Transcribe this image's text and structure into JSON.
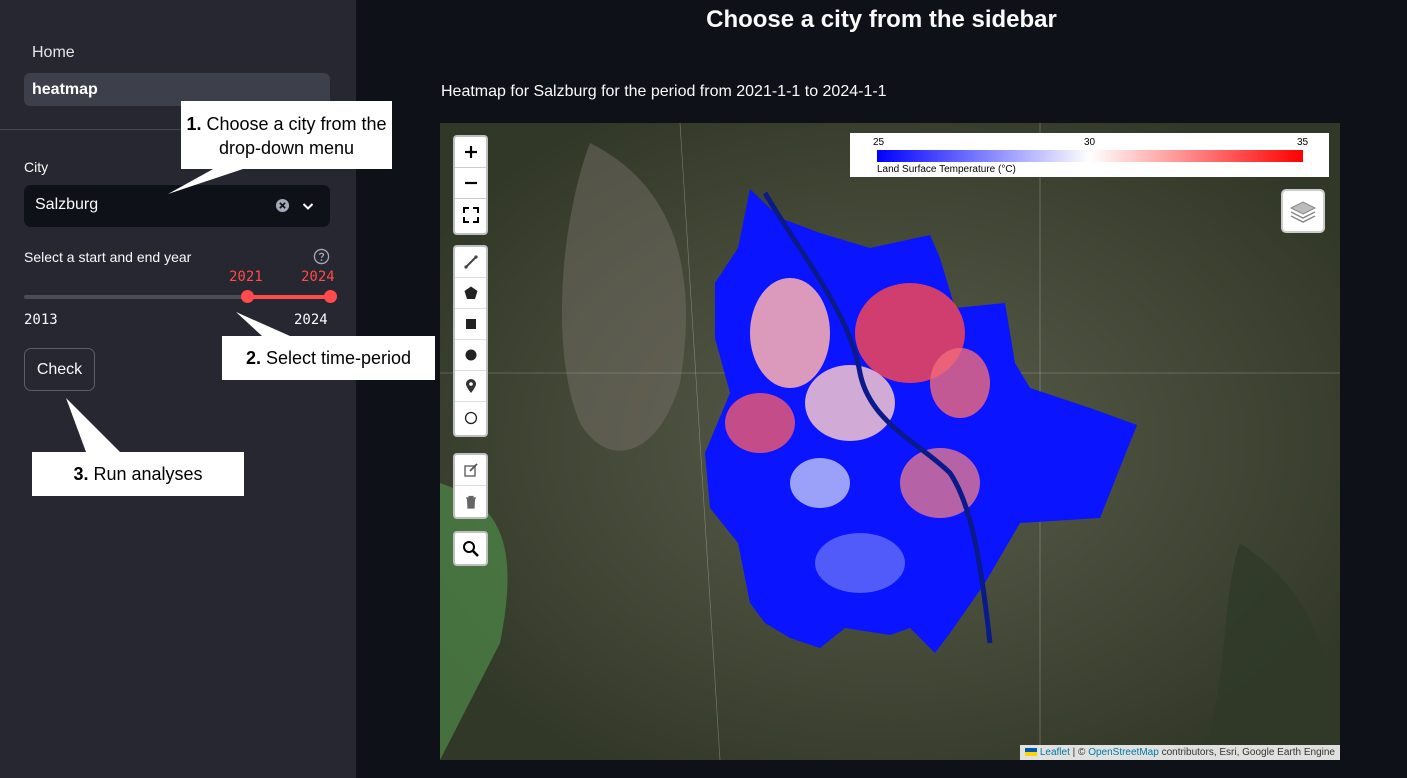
{
  "sidebar": {
    "nav": [
      {
        "label": "Home"
      },
      {
        "label": "heatmap"
      }
    ],
    "city": {
      "label": "City",
      "selected": "Salzburg"
    },
    "year_range": {
      "label": "Select a start and end year",
      "min": "2013",
      "max": "2024",
      "start": "2021",
      "end": "2024",
      "start_fraction": 0.727,
      "end_fraction": 1.0
    },
    "check_label": "Check"
  },
  "callouts": {
    "one": {
      "num": "1.",
      "text": "Choose a city from the drop-down menu"
    },
    "two": {
      "num": "2.",
      "text": "Select time-period"
    },
    "three": {
      "num": "3.",
      "text": "Run analyses"
    }
  },
  "main": {
    "title": "Choose a city from the sidebar",
    "subtitle": "Heatmap for Salzburg for the period from 2021-1-1 to 2024-1-1"
  },
  "map": {
    "legend": {
      "min": "25",
      "mid": "30",
      "max": "35",
      "caption": "Land Surface Temperature (°C)",
      "colors": [
        "#0000ff",
        "#ffffff",
        "#ff0000"
      ]
    },
    "attribution": {
      "leaflet": "Leaflet",
      "sep": " | © ",
      "osm": "OpenStreetMap",
      "rest": " contributors, Esri, Google Earth Engine"
    },
    "tools": [
      "zoom-in",
      "zoom-out",
      "fullscreen",
      "draw-polyline",
      "draw-polygon",
      "draw-rectangle",
      "draw-circle",
      "draw-marker",
      "draw-circlemarker",
      "edit-layers",
      "delete-layers",
      "search"
    ]
  },
  "colors": {
    "accent": "#ff4b4b",
    "sidebar_bg": "#262730",
    "main_bg": "#0e1117"
  }
}
